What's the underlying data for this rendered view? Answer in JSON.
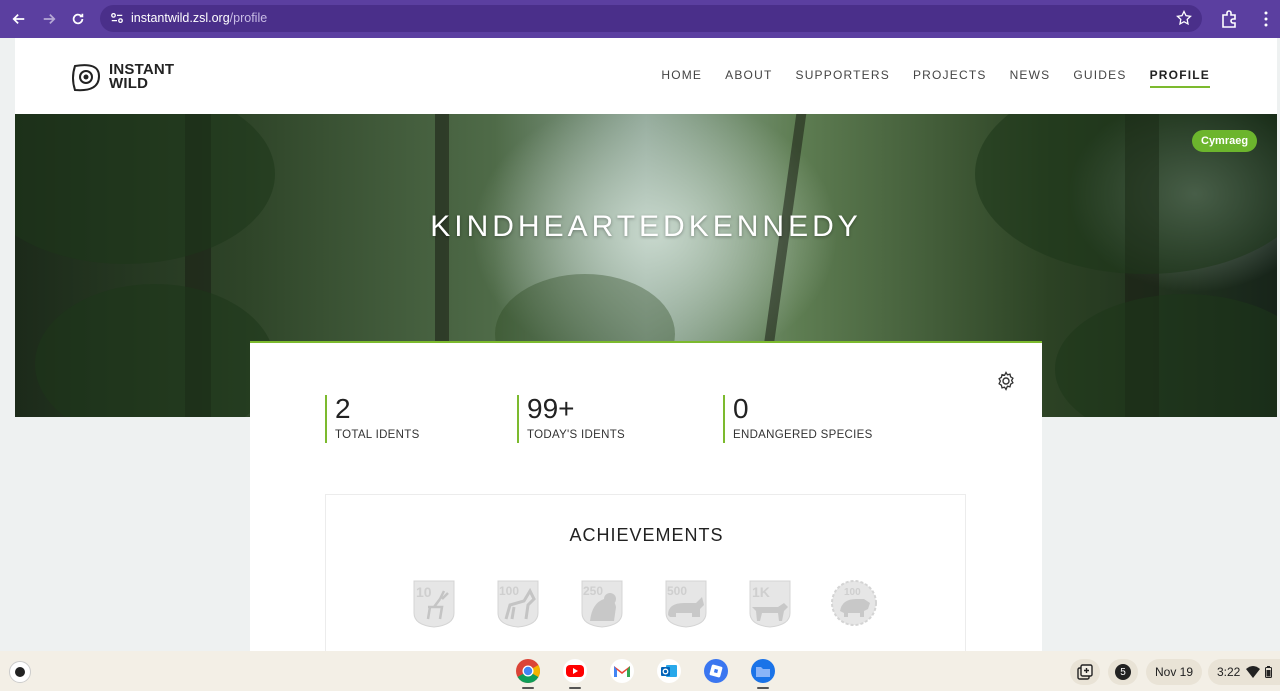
{
  "browser": {
    "url_host": "instantwild.zsl.org",
    "url_path": "/profile"
  },
  "site": {
    "logo_line1": "INSTANT",
    "logo_line2": "WILD",
    "nav": [
      {
        "label": "HOME"
      },
      {
        "label": "ABOUT"
      },
      {
        "label": "SUPPORTERS"
      },
      {
        "label": "PROJECTS"
      },
      {
        "label": "NEWS"
      },
      {
        "label": "GUIDES"
      },
      {
        "label": "PROFILE",
        "active": true
      }
    ]
  },
  "hero": {
    "username": "KINDHEARTEDKENNEDY",
    "language_button": "Cymraeg"
  },
  "stats": [
    {
      "value": "2",
      "label": "TOTAL IDENTS"
    },
    {
      "value": "99+",
      "label": "TODAY'S IDENTS"
    },
    {
      "value": "0",
      "label": "ENDANGERED SPECIES"
    }
  ],
  "achievements": {
    "title": "ACHIEVEMENTS",
    "badges": [
      {
        "number": "10",
        "icon": "deer-icon"
      },
      {
        "number": "100",
        "icon": "wolf-icon"
      },
      {
        "number": "250",
        "icon": "gorilla-icon"
      },
      {
        "number": "500",
        "icon": "rhino-icon"
      },
      {
        "number": "1K",
        "icon": "big-cat-icon"
      },
      {
        "number": "100",
        "icon": "boar-icon"
      }
    ]
  },
  "shelf": {
    "notification_count": "5",
    "date": "Nov 19",
    "time": "3:22"
  }
}
